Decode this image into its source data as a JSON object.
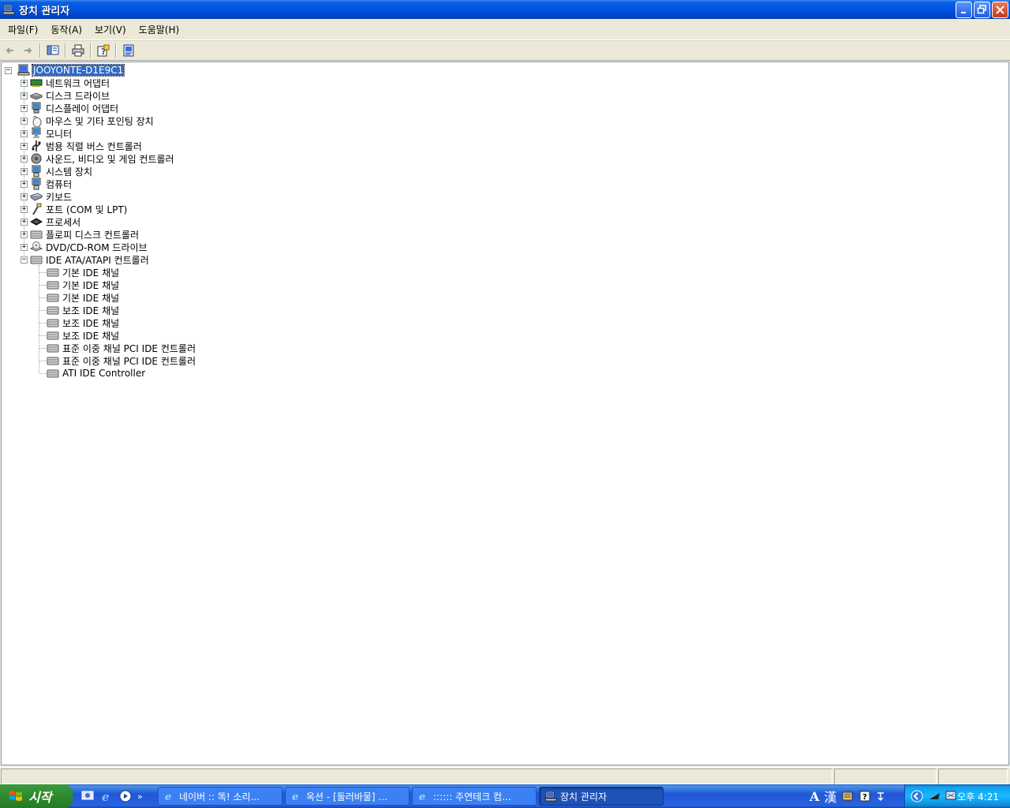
{
  "window": {
    "title": "장치 관리자"
  },
  "menu": [
    {
      "label": "파일(F)"
    },
    {
      "label": "동작(A)"
    },
    {
      "label": "보기(V)"
    },
    {
      "label": "도움말(H)"
    }
  ],
  "toolbar": {
    "buttons": [
      "back-icon",
      "forward-icon",
      "show-hide-tree-icon",
      "print-icon",
      "help-icon",
      "properties-icon"
    ]
  },
  "tree": {
    "root": {
      "label": "JOOYONTE-D1E9C1",
      "icon": "computer-icon",
      "expanded": true,
      "selected": true
    },
    "categories": [
      {
        "label": "네트워크 어댑터",
        "icon": "network-adapter-icon",
        "expanded": false
      },
      {
        "label": "디스크 드라이브",
        "icon": "disk-drive-icon",
        "expanded": false
      },
      {
        "label": "디스플레이 어댑터",
        "icon": "display-adapter-icon",
        "expanded": false
      },
      {
        "label": "마우스 및 기타 포인팅 장치",
        "icon": "mouse-icon",
        "expanded": false
      },
      {
        "label": "모니터",
        "icon": "monitor-icon",
        "expanded": false
      },
      {
        "label": "범용 직렬 버스 컨트롤러",
        "icon": "usb-icon",
        "expanded": false
      },
      {
        "label": "사운드, 비디오 및 게임 컨트롤러",
        "icon": "sound-icon",
        "expanded": false
      },
      {
        "label": "시스템 장치",
        "icon": "system-device-icon",
        "expanded": false
      },
      {
        "label": "컴퓨터",
        "icon": "computer-device-icon",
        "expanded": false
      },
      {
        "label": "키보드",
        "icon": "keyboard-icon",
        "expanded": false
      },
      {
        "label": "포트 (COM 및 LPT)",
        "icon": "port-icon",
        "expanded": false
      },
      {
        "label": "프로세서",
        "icon": "processor-icon",
        "expanded": false
      },
      {
        "label": "플로피 디스크 컨트롤러",
        "icon": "floppy-controller-icon",
        "expanded": false
      },
      {
        "label": "DVD/CD-ROM 드라이브",
        "icon": "dvd-icon",
        "expanded": false
      },
      {
        "label": "IDE ATA/ATAPI 컨트롤러",
        "icon": "ide-controller-icon",
        "expanded": true
      }
    ],
    "ide_children": [
      {
        "label": "기본 IDE 채널"
      },
      {
        "label": "기본 IDE 채널"
      },
      {
        "label": "기본 IDE 채널"
      },
      {
        "label": "보조 IDE 채널"
      },
      {
        "label": "보조 IDE 채널"
      },
      {
        "label": "보조 IDE 채널"
      },
      {
        "label": "표준 이중 채널 PCI IDE 컨트롤러"
      },
      {
        "label": "표준 이중 채널 PCI IDE 컨트롤러"
      },
      {
        "label": "ATI IDE Controller"
      }
    ]
  },
  "taskbar": {
    "start_label": "시작",
    "tasks": [
      {
        "label": "네이버 :: 똑! 소리...",
        "icon": "ie-icon",
        "active": false
      },
      {
        "label": "옥션 - [둘러바물] ...",
        "icon": "ie-icon",
        "active": false
      },
      {
        "label": ":::::: 주연테크 컴...",
        "icon": "ie-icon",
        "active": false
      },
      {
        "label": "장치 관리자",
        "icon": "device-manager-icon",
        "active": true
      }
    ],
    "ime": {
      "mode": "A",
      "hanja": "漢"
    },
    "clock": "오후 4:21"
  }
}
